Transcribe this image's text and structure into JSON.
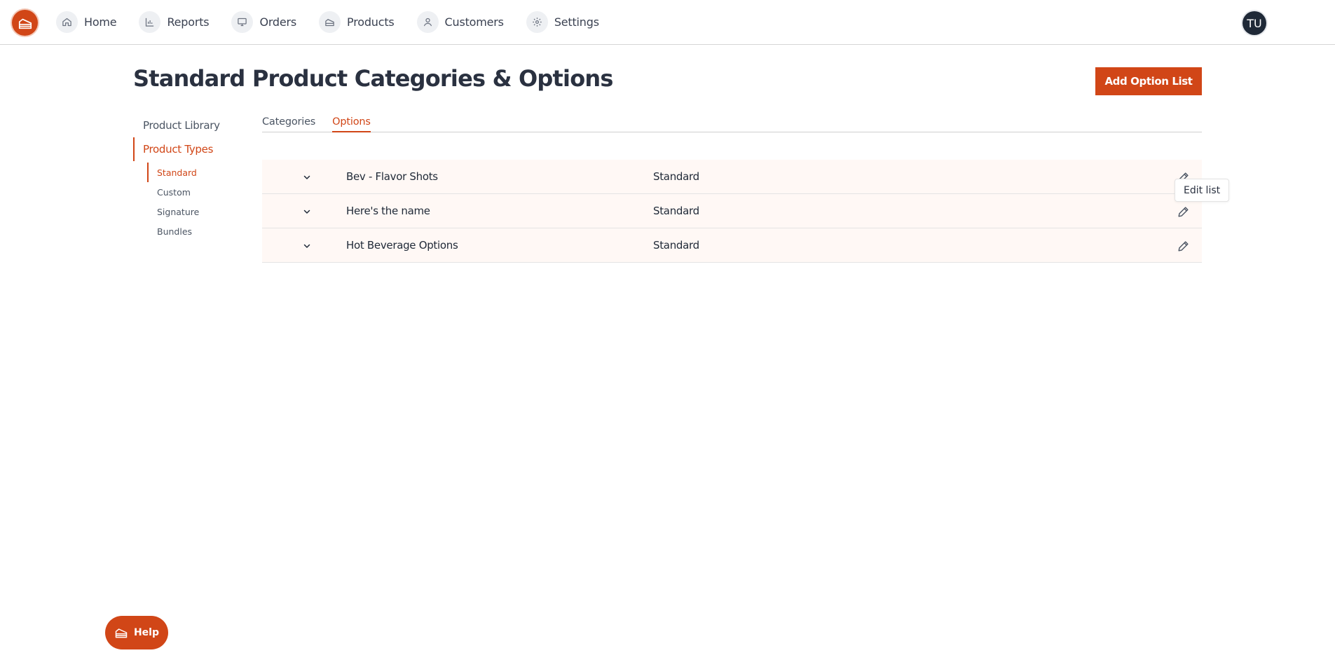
{
  "nav": {
    "items": [
      {
        "label": "Home",
        "icon": "home-icon"
      },
      {
        "label": "Reports",
        "icon": "bar-chart-icon"
      },
      {
        "label": "Orders",
        "icon": "monitor-icon"
      },
      {
        "label": "Products",
        "icon": "cake-icon"
      },
      {
        "label": "Customers",
        "icon": "user-icon"
      },
      {
        "label": "Settings",
        "icon": "gear-icon"
      }
    ],
    "avatar_initials": "TU"
  },
  "header": {
    "title": "Standard Product Categories & Options",
    "add_button_label": "Add Option List"
  },
  "sidebar": {
    "items": [
      {
        "label": "Product Library",
        "active": false
      },
      {
        "label": "Product Types",
        "active": true
      }
    ],
    "sub_items": [
      {
        "label": "Standard",
        "active": true
      },
      {
        "label": "Custom",
        "active": false
      },
      {
        "label": "Signature",
        "active": false
      },
      {
        "label": "Bundles",
        "active": false
      }
    ]
  },
  "tabs": [
    {
      "label": "Categories",
      "active": false
    },
    {
      "label": "Options",
      "active": true
    }
  ],
  "option_lists": [
    {
      "name": "Bev - Flavor Shots",
      "type": "Standard"
    },
    {
      "name": "Here's the name",
      "type": "Standard"
    },
    {
      "name": "Hot Beverage Options",
      "type": "Standard"
    }
  ],
  "tooltip": {
    "text": "Edit list"
  },
  "help": {
    "label": "Help"
  },
  "colors": {
    "accent": "#d14617",
    "row_background": "#fff8f5",
    "text": "#2a3140"
  }
}
